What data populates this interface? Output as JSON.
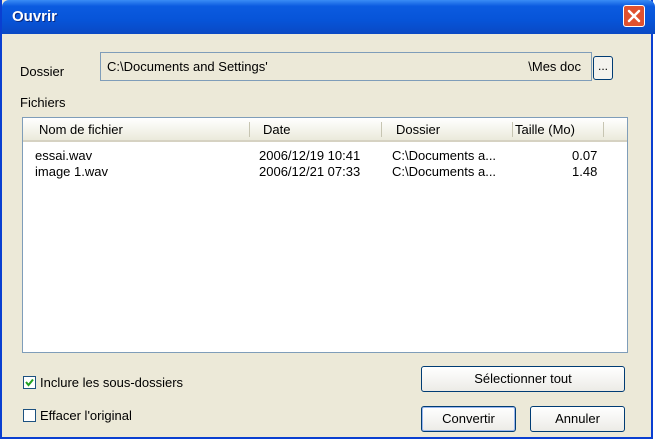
{
  "window": {
    "title": "Ouvrir"
  },
  "dossier": {
    "label": "Dossier",
    "path_start": "C:\\Documents and Settings'",
    "path_end": "\\Mes doc",
    "browse_label": "..."
  },
  "fichiers": {
    "label": "Fichiers",
    "columns": [
      "Nom de fichier",
      "Date",
      "Dossier",
      "Taille (Mo)"
    ],
    "rows": [
      {
        "name": "essai.wav",
        "date": "2006/12/19 10:41",
        "folder": "C:\\Documents a...",
        "size": "0.07"
      },
      {
        "name": "image 1.wav",
        "date": "2006/12/21 07:33",
        "folder": "C:\\Documents a...",
        "size": "1.48"
      }
    ]
  },
  "options": {
    "include_subfolders": {
      "label": "Inclure les sous-dossiers",
      "checked": true
    },
    "delete_original": {
      "label": "Effacer l'original",
      "checked": false
    }
  },
  "buttons": {
    "select_all": "Sélectionner tout",
    "convert": "Convertir",
    "cancel": "Annuler"
  },
  "colors": {
    "titlebar": "#0754d8",
    "close": "#e0512f",
    "face": "#ece9d8"
  }
}
